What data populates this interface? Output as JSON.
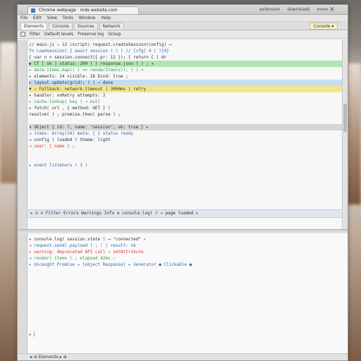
{
  "window": {
    "title": "Chrome webpage · mde.website.com",
    "controls": [
      "extension",
      "downloads",
      "more"
    ],
    "close_symbol": "×"
  },
  "menu": [
    "File",
    "Edit",
    "View",
    "Tools",
    "Window",
    "Help"
  ],
  "tabs": [
    {
      "label": "Elements",
      "active": true
    },
    {
      "label": "Console",
      "active": false
    },
    {
      "label": "Sources",
      "active": false
    },
    {
      "label": "Network",
      "active": false
    }
  ],
  "tab_right_label": "Console ▾",
  "toolbar": [
    "Filter",
    "Default levels",
    "Preserve log",
    "Group"
  ],
  "editor_lines": [
    "// main.js — 12 ⟨script⟩ request.createSession(config) ⟶",
    "  fn Loadsession(  { await session ( ) ) // [cfg] 4 ( ){0}",
    "    { var n = session.connect({ pr: 12 }); { return C ( dr",
    "  ▶ CT  [ ok ]  status: 200  ( ) response.json ( ) ; ◂",
    "    ✔  data.items.map(( ) => renderItem(x)); (  ) =",
    "    ▸  elements: 24  visible: 18  bind: true ;",
    "    ▸  layout.update(grid); ( ) → done",
    "  ▼ ⚠ Fallback: network.timeout ( 3000ms ) retry",
    "    ▸  handler: onRetry  attempts: 2",
    "    ▸  cache.lookup( key ) → null",
    "  ▸ fetch( url , { method: GET } )",
    "    resolve( ) ; promise.then( parse ) ;",
    "",
    "  ◂ Object { id: 7, name: \"session\", ok: true } ▸",
    "      ⟶ items: Array(24)  meta: { }  status ready",
    "      ⟶ config ( loaded )  theme: light",
    "      ⟶ user: { name } ;",
    "",
    "",
    "  ▸ event listeners  ( 3 )"
  ],
  "split_bar_text": "▸ ⊙ ⊘  Filter   Errors   Warnings   Info   ⊕ console.log( ) → page loaded   ▸",
  "console_lines": [
    "  ▸ console.log( session.state )  ⟶ \"connected\"  ✓",
    "    ⟶ request.send( payload ) ; ( ) result: ok",
    "  ▸ warning: deprecated API call  → setAttribute",
    "    ⟶ render( items ) ; elapsed 42ms ✓",
    "  ▸ Uncaught Promise → [object Response]  ▸  Generator   ● Clickable ●",
    "",
    "",
    "",
    "",
    "",
    "",
    "",
    "",
    "",
    "",
    "  ▸ ▏"
  ],
  "status_text": "▸ ⊘ Elements ▸ ⊕"
}
